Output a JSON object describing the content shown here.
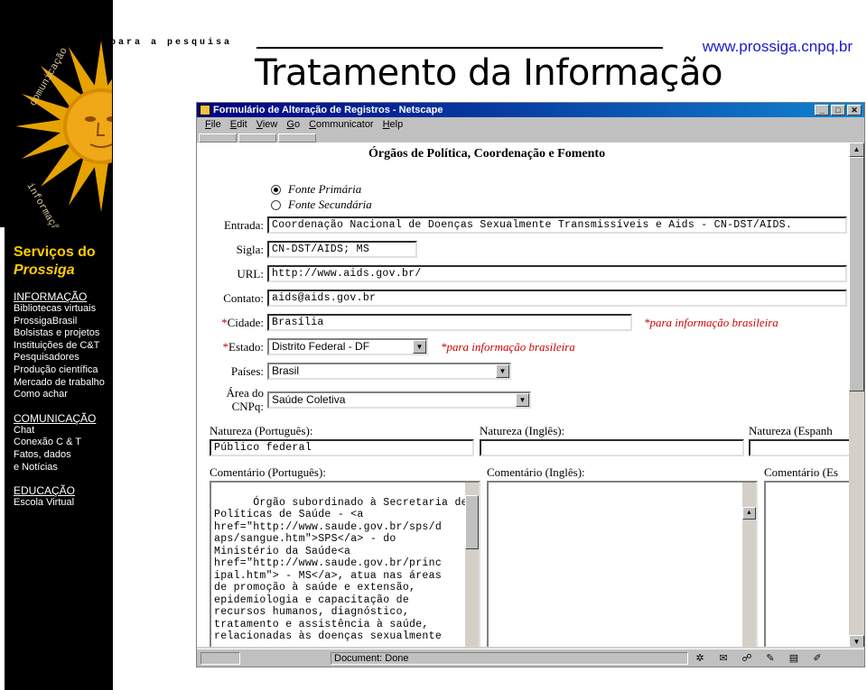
{
  "sidebar": {
    "logo_circle_text": "comunicação e informação",
    "tagline": "para a pesquisa",
    "title_line1": "Serviços do",
    "title_line2": "Prossiga",
    "sections": [
      {
        "heading": "INFORMAÇÃO",
        "items": [
          "Bibliotecas virtuais",
          "ProssigaBrasil",
          "Bolsistas e projetos",
          "Instituições de C&T",
          "Pesquisadores",
          "Produção científica",
          "Mercado de trabalho",
          "Como achar"
        ]
      },
      {
        "heading": "COMUNICAÇÃO",
        "items": [
          "Chat",
          "Conexão C & T",
          "Fatos, dados",
          "e Notícias"
        ]
      },
      {
        "heading": "EDUCAÇÃO",
        "items": [
          "Escola Virtual"
        ]
      }
    ]
  },
  "header": {
    "url": "www.prossiga.cnpq.br",
    "title": "Tratamento da Informação"
  },
  "browser": {
    "window_title": "Formulário de Alteração de Registros - Netscape",
    "menu": [
      "File",
      "Edit",
      "View",
      "Go",
      "Communicator",
      "Help"
    ],
    "status_text": "Document: Done",
    "colors": {
      "titlebar": "#000080",
      "required": "#cc0000"
    }
  },
  "form": {
    "heading": "Órgãos de Política, Coordenação e Fomento",
    "radio_primary": "Fonte Primária",
    "radio_secondary": "Fonte Secundária",
    "entrada_label": "Entrada:",
    "entrada_value": "Coordenação Nacional de Doenças Sexualmente Transmissíveis e Aids - CN-DST/AIDS.",
    "sigla_label": "Sigla:",
    "sigla_value": "CN-DST/AIDS; MS",
    "url_label": "URL:",
    "url_value": "http://www.aids.gov.br/",
    "contato_label": "Contato:",
    "contato_value": "aids@aids.gov.br",
    "cidade_label": "Cidade:",
    "cidade_value": "Brasília",
    "cidade_note": "*para informação brasileira",
    "estado_label": "Estado:",
    "estado_value": "Distrito Federal - DF",
    "estado_note": "*para informação brasileira",
    "paises_label": "Países:",
    "paises_value": "Brasil",
    "area_label_1": "Área do",
    "area_label_2": "CNPq:",
    "area_value": "Saúde Coletiva",
    "req_mark": "*",
    "natureza_pt_label": "Natureza (Português):",
    "natureza_pt_value": "Público federal",
    "natureza_en_label": "Natureza (Inglês):",
    "natureza_es_label": "Natureza (Espanh",
    "comentario_pt_label": "Comentário (Português):",
    "comentario_en_label": "Comentário (Inglês):",
    "comentario_es_label": "Comentário (Es",
    "comentario_pt_value": "Órgão subordinado à Secretaria de\nPolíticas de Saúde - <a\nhref=\"http://www.saude.gov.br/sps/d\naps/sangue.htm\">SPS</a> - do\nMinistério da Saúde<a\nhref=\"http://www.saude.gov.br/princ\nipal.htm\"> - MS</a>, atua nas áreas\nde promoção à saúde e extensão,\nepidemiologia e capacitação de\nrecursos humanos, diagnóstico,\ntratamento e assistência à saúde,\nrelacionadas às doenças sexualmente"
  }
}
